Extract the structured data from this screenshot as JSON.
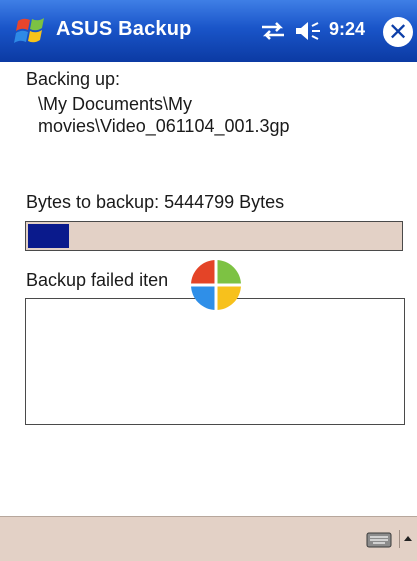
{
  "titlebar": {
    "app_title": "ASUS Backup",
    "clock": "9:24",
    "close_glyph": "✕",
    "icons": [
      "windows-start-icon",
      "sync-icon",
      "volume-icon",
      "close-icon"
    ]
  },
  "content": {
    "backing_label": "Backing up:",
    "file_path_line1": "\\My Documents\\My",
    "file_path_line2": "movies\\Video_061104_001.3gp",
    "bytes_label": "Bytes to backup: 5444799 Bytes",
    "progress_fraction": 0.11,
    "failed_label": "Backup failed iten",
    "failed_items": []
  },
  "bottombar": {
    "icons": [
      "keyboard-icon",
      "sip-arrow-icon"
    ]
  },
  "colors": {
    "titlebar": "#1a55c9",
    "progress_fill": "#0a1a8c",
    "bar_background": "#e3d1c6"
  }
}
